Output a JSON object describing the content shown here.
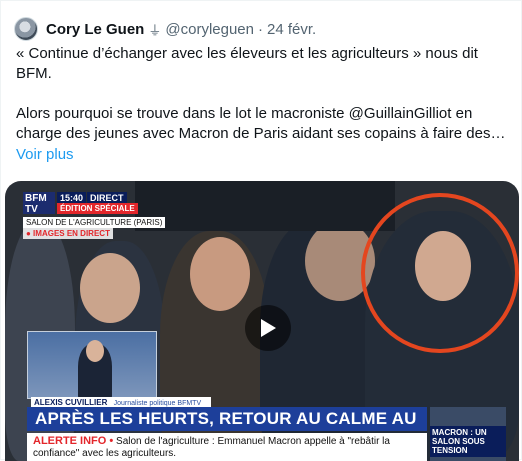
{
  "tweet": {
    "author_name": "Cory Le Guen",
    "verified_glyph": "⏚",
    "handle": "@coryleguen",
    "separator": "·",
    "date": "24 févr.",
    "text": "« Continue d’échanger avec les éleveurs et les agriculteurs » nous dit BFM.\n\nAlors pourquoi se trouve dans le lot le macroniste @GuillainGilliot en charge des jeunes avec Macron de Paris aidant ses copains à faire des…",
    "see_more": "Voir plus"
  },
  "video": {
    "icons": {
      "play": "play-icon"
    },
    "overlay": {
      "logo": "BFM TV",
      "time": "15:40",
      "direct": "DIRECT",
      "edition": "ÉDITION SPÉCIALE",
      "location": "SALON DE L'AGRICULTURE (PARIS)",
      "live_images": "● IMAGES EN DIRECT",
      "caption_name": "ALEXIS CUVILLIER",
      "caption_role": "Journaliste politique BFMTV",
      "banner": "APRÈS LES HEURTS, RETOUR AU CALME AU SALON",
      "alert_label": "ALERTE INFO •",
      "alert_text": "Salon de l'agriculture : Emmanuel Macron appelle à \"rebâtir la confiance\" avec les agriculteurs.",
      "side_label": "MACRON : UN SALON SOUS TENSION"
    },
    "highlight_color": "#e4461f"
  },
  "colors": {
    "link": "#1d9bf0",
    "muted": "#536471",
    "bfm_blue": "#1d3f9a",
    "bfm_red": "#e3262b"
  }
}
